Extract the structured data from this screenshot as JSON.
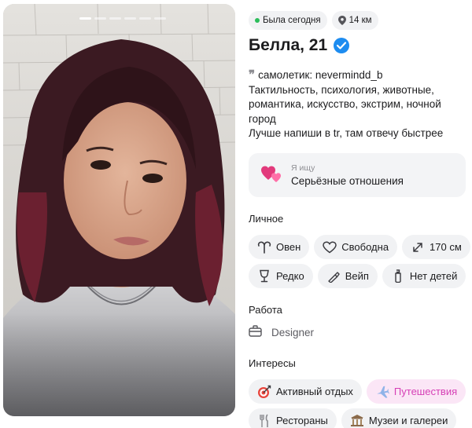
{
  "status": {
    "last_seen": "Была сегодня",
    "distance": "14 км"
  },
  "profile": {
    "name_age": "Белла, 21"
  },
  "bio": {
    "quote_mark": "99",
    "lines": [
      "самолетик: nevermindd_b",
      "Тактильность, психология, животные,",
      "романтика, искусство, экстрим, ночной",
      "город",
      "Лучше напиши в tr, там отвечу быстрее"
    ]
  },
  "looking_for": {
    "label": "Я ищу",
    "value": "Серьёзные отношения",
    "icon": "two-hearts-icon"
  },
  "personal": {
    "title": "Личное",
    "tags_row1": [
      {
        "label": "Овен",
        "icon": "aries-icon"
      },
      {
        "label": "Свободна",
        "icon": "heart-outline-icon"
      },
      {
        "label": "170 см",
        "icon": "resize-arrows-icon"
      }
    ],
    "tags_row2": [
      {
        "label": "Редко",
        "icon": "wine-glass-icon"
      },
      {
        "label": "Вейп",
        "icon": "vape-icon"
      },
      {
        "label": "Нет детей",
        "icon": "baby-bottle-icon"
      }
    ]
  },
  "work": {
    "title": "Работа",
    "value": "Designer",
    "icon": "briefcase-icon"
  },
  "interests": {
    "title": "Интересы",
    "row1": [
      {
        "label": "Активный отдых",
        "icon": "target-icon",
        "highlight": false
      },
      {
        "label": "Путешествия",
        "icon": "airplane-icon",
        "highlight": true
      }
    ],
    "row2": [
      {
        "label": "Рестораны",
        "icon": "cutlery-icon",
        "highlight": false
      },
      {
        "label": "Музеи и галереи",
        "icon": "museum-icon",
        "highlight": false
      }
    ]
  },
  "photo": {
    "count": 6,
    "active_index": 0
  },
  "colors": {
    "accent_blue": "#1d8cf0",
    "online_green": "#2bbd5a",
    "highlight_pink": "#d63fb6",
    "chip_bg": "#f1f2f4"
  }
}
